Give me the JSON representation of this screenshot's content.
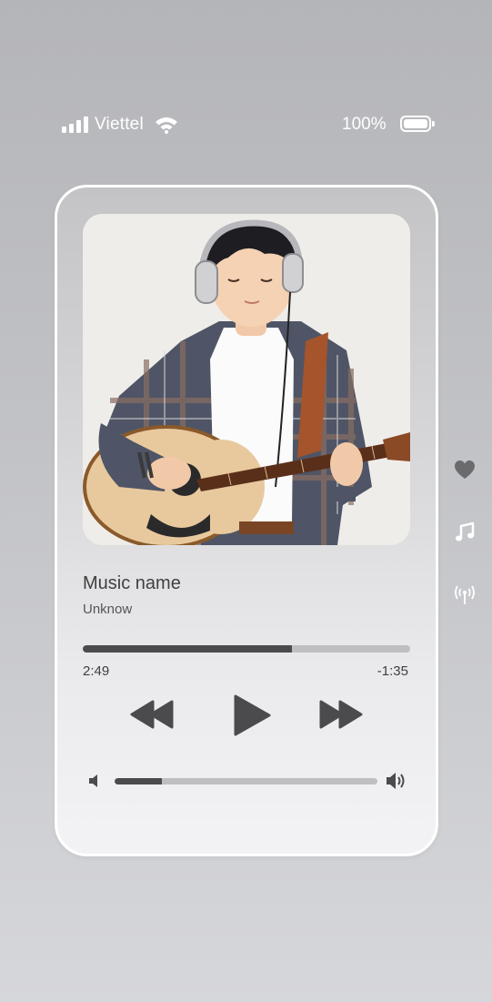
{
  "status_bar": {
    "carrier": "Viettel",
    "battery_percent": "100%",
    "signal_bars": 4,
    "icons": [
      "signal-icon",
      "wifi-icon",
      "battery-icon"
    ]
  },
  "player": {
    "song_title": "Music name",
    "artist": "Unknow",
    "time_elapsed": "2:49",
    "time_remaining": "-1:35",
    "progress_fraction": 0.64,
    "volume_fraction": 0.18,
    "controls": [
      "rewind-icon",
      "play-icon",
      "fast-forward-icon"
    ],
    "volume_icons": [
      "volume-low-icon",
      "volume-high-icon"
    ]
  },
  "side_actions": [
    "heart-icon",
    "music-note-icon",
    "broadcast-icon"
  ],
  "colors": {
    "accent": "#4b4b4d",
    "track": "#bfbfc1",
    "text": "#404040",
    "heart": "#6b6b6d",
    "white": "#ffffff"
  }
}
